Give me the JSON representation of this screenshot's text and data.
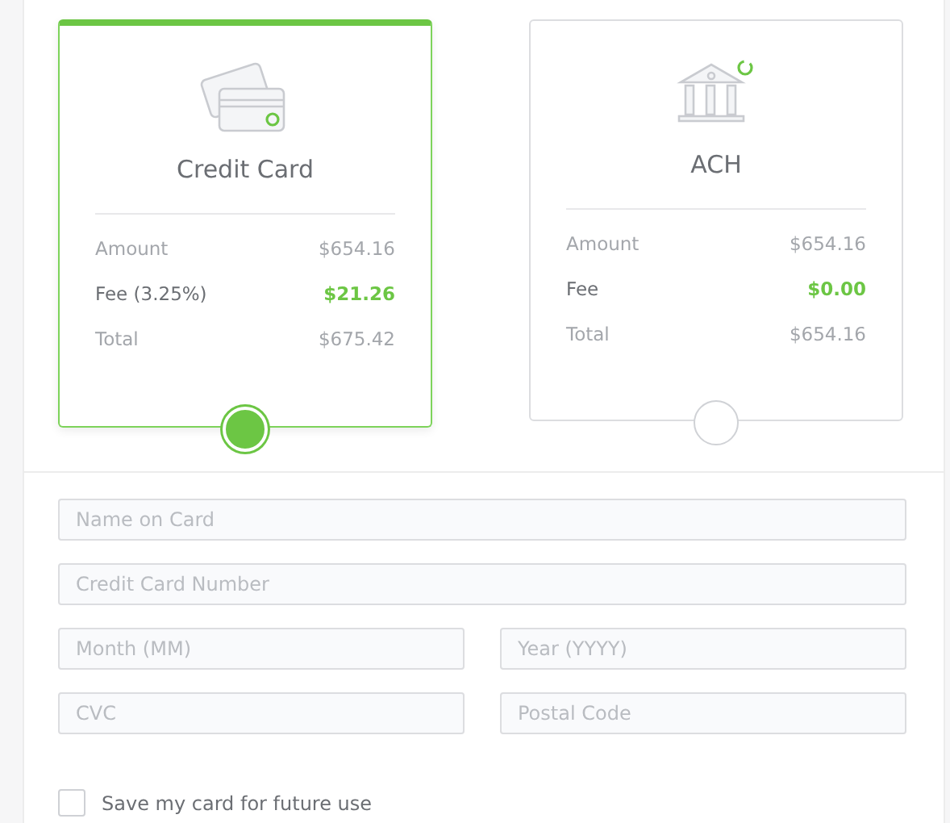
{
  "payment_methods": [
    {
      "kind": "card",
      "title": "Credit Card",
      "selected": true,
      "rows": [
        {
          "label": "Amount",
          "value": "$654.16",
          "kind": "plain"
        },
        {
          "label": "Fee (3.25%)",
          "value": "$21.26",
          "kind": "fee"
        },
        {
          "label": "Total",
          "value": "$675.42",
          "kind": "plain"
        }
      ]
    },
    {
      "kind": "bank",
      "title": "ACH",
      "selected": false,
      "rows": [
        {
          "label": "Amount",
          "value": "$654.16",
          "kind": "plain"
        },
        {
          "label": "Fee",
          "value": "$0.00",
          "kind": "fee"
        },
        {
          "label": "Total",
          "value": "$654.16",
          "kind": "plain"
        }
      ]
    }
  ],
  "fields": [
    [
      {
        "placeholder": "Name on Card"
      }
    ],
    [
      {
        "placeholder": "Credit Card Number"
      }
    ],
    [
      {
        "placeholder": "Month (MM)"
      },
      {
        "placeholder": "Year (YYYY)"
      }
    ],
    [
      {
        "placeholder": "CVC"
      },
      {
        "placeholder": "Postal Code"
      }
    ]
  ],
  "save_card": {
    "label": "Save my card for future use",
    "checked": false
  }
}
